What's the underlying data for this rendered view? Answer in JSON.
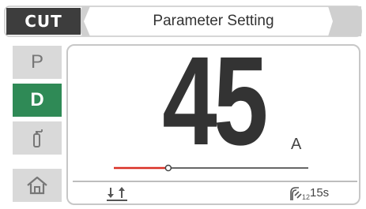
{
  "header": {
    "mode": "CUT",
    "title": "Parameter Setting"
  },
  "sidebar": {
    "items": [
      {
        "label": "P",
        "active": false
      },
      {
        "label": "D",
        "active": true
      },
      {
        "icon": "gas-cylinder-icon",
        "active": false
      },
      {
        "icon": "home-icon",
        "active": false
      }
    ]
  },
  "main": {
    "value": "45",
    "unit": "A",
    "slider_level_fraction": 0.28,
    "trigger_icon": "two-step-trigger-icon",
    "timer": {
      "icon": "post-flow-gas-icon",
      "sub_label": "t2",
      "value": "15s"
    }
  },
  "colors": {
    "header_dark": "#3d3d3d",
    "active_green": "#2f8a56",
    "slider_fill": "#d93025",
    "inactive_button": "#d9d9d9"
  }
}
